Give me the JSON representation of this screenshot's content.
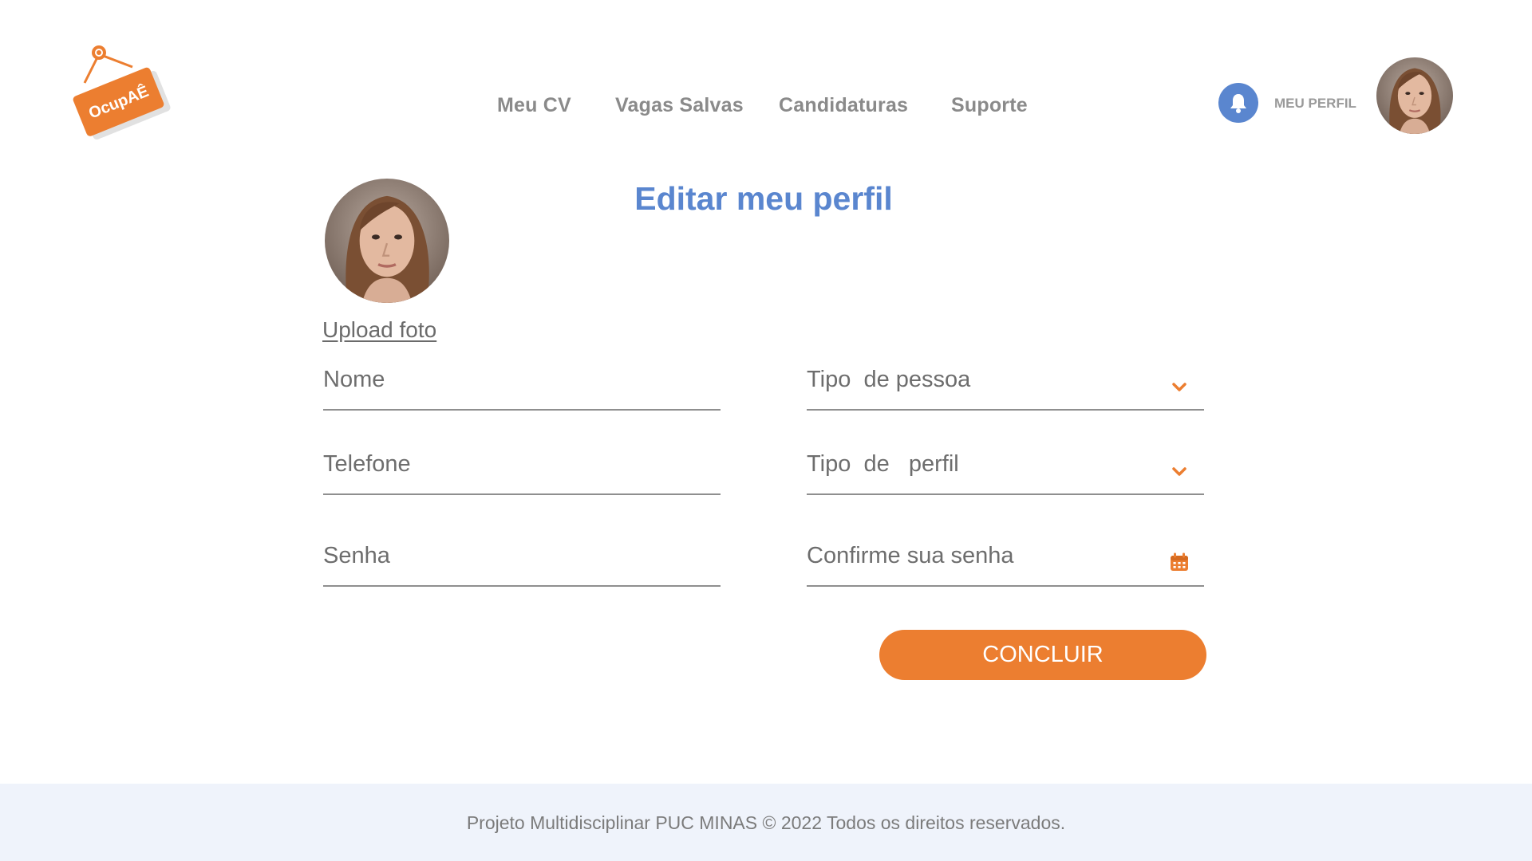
{
  "logo": {
    "text": "OcupAÊ"
  },
  "nav": {
    "items": [
      {
        "label": "Meu CV"
      },
      {
        "label": "Vagas Salvas"
      },
      {
        "label": "Candidaturas"
      },
      {
        "label": "Suporte"
      }
    ]
  },
  "header": {
    "notification_icon": "bell-icon",
    "profile_label": "MEU PERFIL"
  },
  "main": {
    "title": "Editar meu perfil",
    "upload_label": "Upload foto",
    "fields": {
      "nome": {
        "placeholder": "Nome"
      },
      "tipo_pessoa": {
        "placeholder": "Tipo  de pessoa",
        "icon": "chevron-down-icon"
      },
      "telefone": {
        "placeholder": "Telefone"
      },
      "tipo_perfil": {
        "placeholder": "Tipo  de   perfil",
        "icon": "chevron-down-icon"
      },
      "senha": {
        "placeholder": "Senha"
      },
      "confirme_senha": {
        "placeholder": "Confirme sua senha",
        "icon": "calendar-icon"
      }
    },
    "submit_label": "CONCLUIR"
  },
  "footer": {
    "text": "Projeto Multidisciplinar  PUC MINAS © 2022 Todos os direitos reservados."
  },
  "colors": {
    "accent": "#ec7e30",
    "brand_blue": "#5a86cf",
    "footer_bg": "#eff3fb"
  }
}
